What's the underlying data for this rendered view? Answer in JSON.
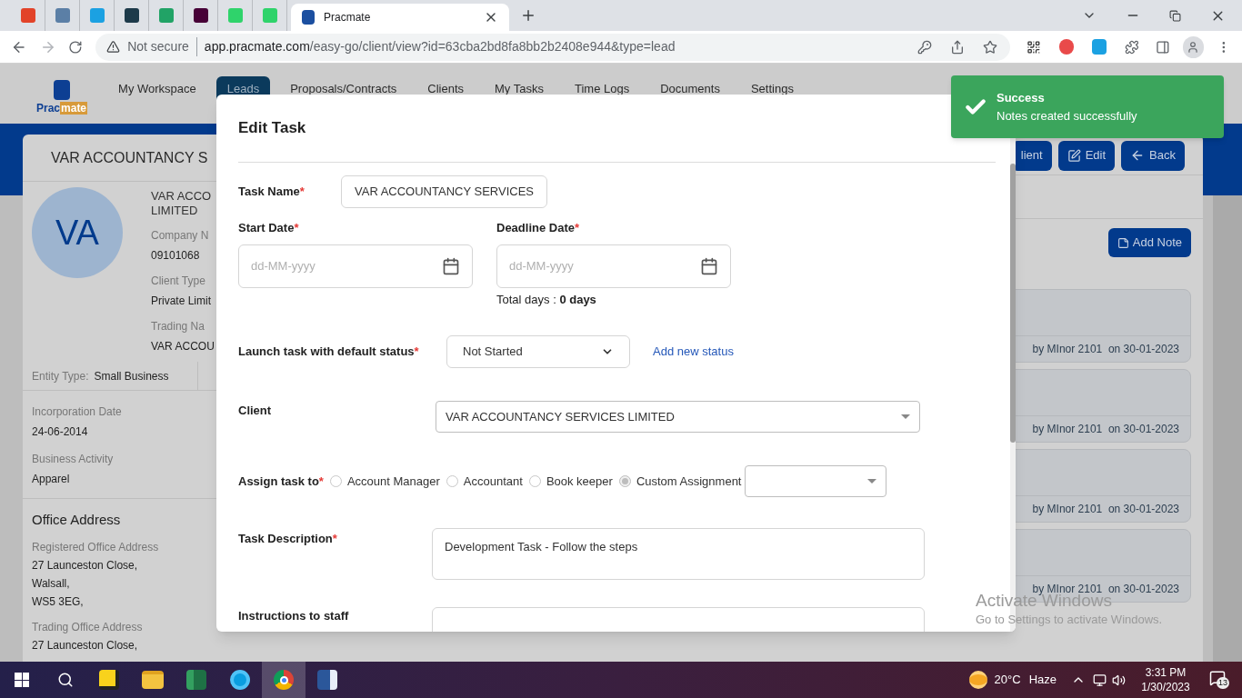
{
  "browser": {
    "pinned_tabs": [
      {
        "color": "#e24329"
      },
      {
        "color": "#5b7fa6"
      },
      {
        "color": "#1ba1e2"
      },
      {
        "color": "#1d3a4a"
      },
      {
        "color": "#21a366"
      },
      {
        "color": "#470137"
      },
      {
        "color": "#2fd36b"
      },
      {
        "color": "#2fd36b"
      }
    ],
    "tabs": [
      {
        "title": "Pracmate",
        "selected": true
      }
    ],
    "security": "Not secure",
    "url_host": "app.pracmate.com",
    "url_path": "/easy-go/client/view?id=63cba2bd8fa8bb2b2408e944&type=lead"
  },
  "nav": {
    "logo_a": "Prac",
    "logo_b": "mate",
    "items": [
      {
        "label": "My Workspace",
        "selected": false
      },
      {
        "label": "Leads",
        "selected": true
      },
      {
        "label": "Proposals/Contracts",
        "selected": false
      },
      {
        "label": "Clients",
        "selected": false
      },
      {
        "label": "My Tasks",
        "selected": false
      },
      {
        "label": "Time Logs",
        "selected": false
      },
      {
        "label": "Documents",
        "selected": false
      },
      {
        "label": "Settings",
        "selected": false
      }
    ]
  },
  "client_card": {
    "title": "VAR ACCOUNTANCY S",
    "initials": "VA",
    "name_lines": [
      "VAR ACCO",
      "LIMITED"
    ],
    "fields": [
      {
        "label": "Company N",
        "value": "09101068"
      },
      {
        "label": "Client Type",
        "value": "Private Limit"
      },
      {
        "label": "Trading Na",
        "value": "VAR ACCOU"
      }
    ],
    "entity_label": "Entity Type:",
    "entity_value": "Small Business",
    "details": [
      {
        "label": "Incorporation Date",
        "value": "24-06-2014"
      },
      {
        "label": "Business Activity",
        "value": "Apparel"
      }
    ],
    "address_heading": "Office Address",
    "addresses": [
      {
        "label": "Registered Office Address",
        "lines": [
          "27 Launceston Close,",
          "Walsall,",
          "WS5 3EG,"
        ]
      },
      {
        "label": "Trading Office Address",
        "lines": [
          "27 Launceston Close,"
        ]
      }
    ]
  },
  "actions": [
    {
      "kind": "plain",
      "label": "lient"
    },
    {
      "kind": "edit",
      "label": "Edit"
    },
    {
      "kind": "back",
      "label": "Back"
    }
  ],
  "notes": {
    "add_label": "Add Note",
    "items": [
      {
        "meta": "by MInor 2101  on 30-01-2023"
      },
      {
        "meta": "by MInor 2101  on 30-01-2023"
      },
      {
        "meta": "by MInor 2101  on 30-01-2023"
      },
      {
        "meta": "by MInor 2101  on 30-01-2023"
      }
    ]
  },
  "modal": {
    "title": "Edit Task",
    "task_name": {
      "label": "Task Name",
      "mark": "*",
      "value": "VAR ACCOUNTANCY SERVICES"
    },
    "start_date": {
      "label": "Start Date",
      "mark": "*",
      "placeholder": "dd-MM-yyyy"
    },
    "deadline_date": {
      "label": "Deadline Date",
      "mark": "*",
      "placeholder": "dd-MM-yyyy"
    },
    "total_days": "Total days : **0 days**",
    "status": {
      "label": "Launch task with default status",
      "mark": "*",
      "value": "Not Started",
      "link": "Add new status"
    },
    "client": {
      "label": "Client",
      "value": "VAR ACCOUNTANCY SERVICES LIMITED"
    },
    "assign": {
      "label": "Assign task to",
      "mark": "*",
      "options": [
        {
          "label": "Account Manager",
          "selected": false
        },
        {
          "label": "Accountant",
          "selected": false
        },
        {
          "label": "Book keeper",
          "selected": false
        },
        {
          "label": "Custom Assignment",
          "selected": true
        }
      ]
    },
    "description": {
      "label": "Task Description",
      "mark": "*",
      "value": "Development Task - Follow the steps"
    },
    "instructions": {
      "label": "Instructions to staff"
    }
  },
  "toast": {
    "title": "Success",
    "message": "Notes created successfully"
  },
  "os_notice": {
    "title": "Activate Windows",
    "message": "Go to Settings to activate Windows."
  },
  "taskbar": {
    "apps": [
      {
        "kind": "notes",
        "selected": false
      },
      {
        "kind": "folder",
        "selected": false
      },
      {
        "kind": "sheet",
        "selected": false
      },
      {
        "kind": "chat",
        "selected": false
      },
      {
        "kind": "browser",
        "selected": true
      },
      {
        "kind": "doc",
        "selected": false
      }
    ],
    "temperature": "20°C",
    "weather": "Haze",
    "time": "3:31 PM",
    "date": "1/30/2023",
    "notifications": "13"
  }
}
